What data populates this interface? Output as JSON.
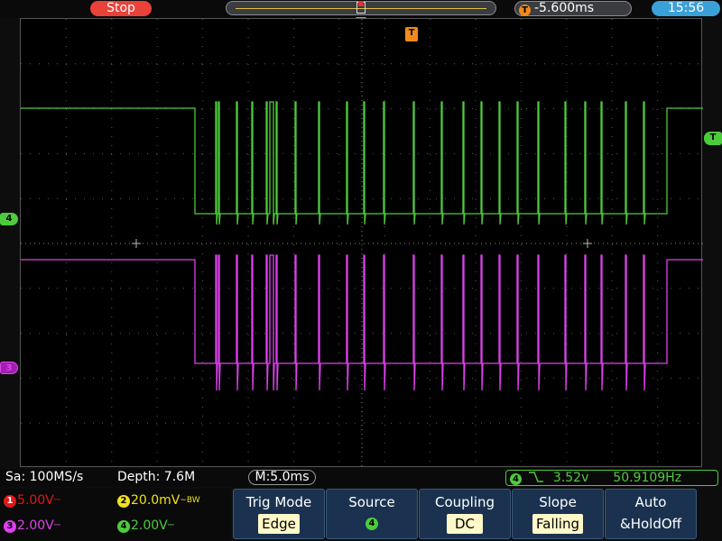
{
  "topbar": {
    "run_state": "Stop",
    "trigger_offset": "-5.600ms",
    "trigger_badge": "T",
    "clock": "15:56"
  },
  "markers": {
    "trigger_time": "T",
    "trigger_level": "T",
    "ch4": "4",
    "ch3": "3"
  },
  "info": {
    "sample_rate": "Sa: 100MS/s",
    "depth": "Depth: 7.6M",
    "m_time": "M:5.0ms",
    "trigger_channel": "4",
    "trigger_level": "3.52v",
    "frequency": "50.9109Hz"
  },
  "channels": [
    {
      "num": "1",
      "scale": "5.00V",
      "coupling": "⎓",
      "color": "#e01818"
    },
    {
      "num": "2",
      "scale": "20.0mV",
      "coupling": "∼BW",
      "color": "#f0e020"
    },
    {
      "num": "3",
      "scale": "2.00V",
      "coupling": "⎓",
      "color": "#e040f0"
    },
    {
      "num": "4",
      "scale": "2.00V",
      "coupling": "⎓",
      "color": "#4ccc3c"
    }
  ],
  "menu": [
    {
      "label": "Trig Mode",
      "value": "Edge"
    },
    {
      "label": "Source",
      "value": "4"
    },
    {
      "label": "Coupling",
      "value": "DC"
    },
    {
      "label": "Slope",
      "value": "Falling"
    },
    {
      "label": "Auto",
      "value": "&HoldOff"
    }
  ],
  "colors": {
    "ch3_trace": "#e040f0",
    "ch4_trace": "#4ccc3c",
    "trigger": "#f08a1c",
    "menu_bg": "#1a3250"
  }
}
